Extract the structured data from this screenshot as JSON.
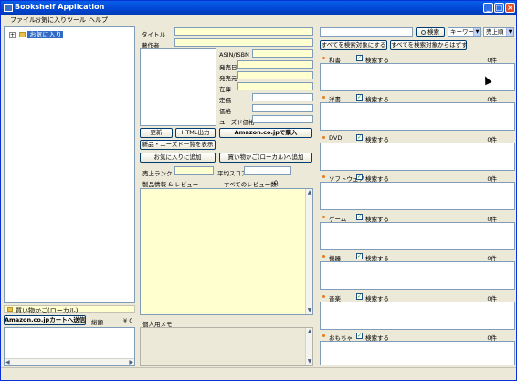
{
  "window": {
    "title": "Bookshelf Application"
  },
  "menu": [
    "ファイル",
    "お気に入り",
    "ツール",
    "ヘルプ"
  ],
  "tree": {
    "root": "お気に入り"
  },
  "cart": {
    "header": "買い物かご(ローカル)",
    "send_button": "Amazon.co.jpカートへ送信",
    "total_label": "総額",
    "total_value": "¥ 0"
  },
  "detail": {
    "title_label": "タイトル",
    "author_label": "著作者",
    "asin_label": "ASIN/ISBN",
    "release_label": "発売日",
    "publisher_label": "発売元",
    "stock_label": "在庫",
    "list_price_label": "定価",
    "price_label": "価格",
    "used_price_label": "ユーズド価格"
  },
  "buttons": {
    "update": "更新",
    "html_output": "HTML出力",
    "buy_amazon": "Amazon.co.jpで購入",
    "new_used_list": "新品・ユーズド一覧を表示",
    "add_favorite": "お気に入りに追加",
    "add_cart": "買い物かご(ローカル)へ追加"
  },
  "sales_rank_label": "売上ランク",
  "avg_score_label": "平均スコア",
  "product_info_label": "製品情報 & レビュー",
  "all_reviews_label": "すべてのレビュー数:",
  "all_reviews_value": "0",
  "personal_memo_label": "個人用メモ",
  "search": {
    "button": "検索",
    "type": "キーワード",
    "sort": "売上順",
    "select_all": "すべてを検索対象にする",
    "deselect_all": "すべてを検索対象からはずす"
  },
  "categories": [
    {
      "name": "和書",
      "check_label": "検索する",
      "count": "0件"
    },
    {
      "name": "洋書",
      "check_label": "検索する",
      "count": "0件"
    },
    {
      "name": "DVD",
      "check_label": "検索する",
      "count": "0件"
    },
    {
      "name": "ソフトウェア",
      "check_label": "検索する",
      "count": "0件"
    },
    {
      "name": "ゲーム",
      "check_label": "検索する",
      "count": "0件"
    },
    {
      "name": "機器",
      "check_label": "検索する",
      "count": "0件"
    },
    {
      "name": "音楽",
      "check_label": "検索する",
      "count": "0件"
    },
    {
      "name": "おもちゃ",
      "check_label": "検索する",
      "count": "0件"
    }
  ]
}
